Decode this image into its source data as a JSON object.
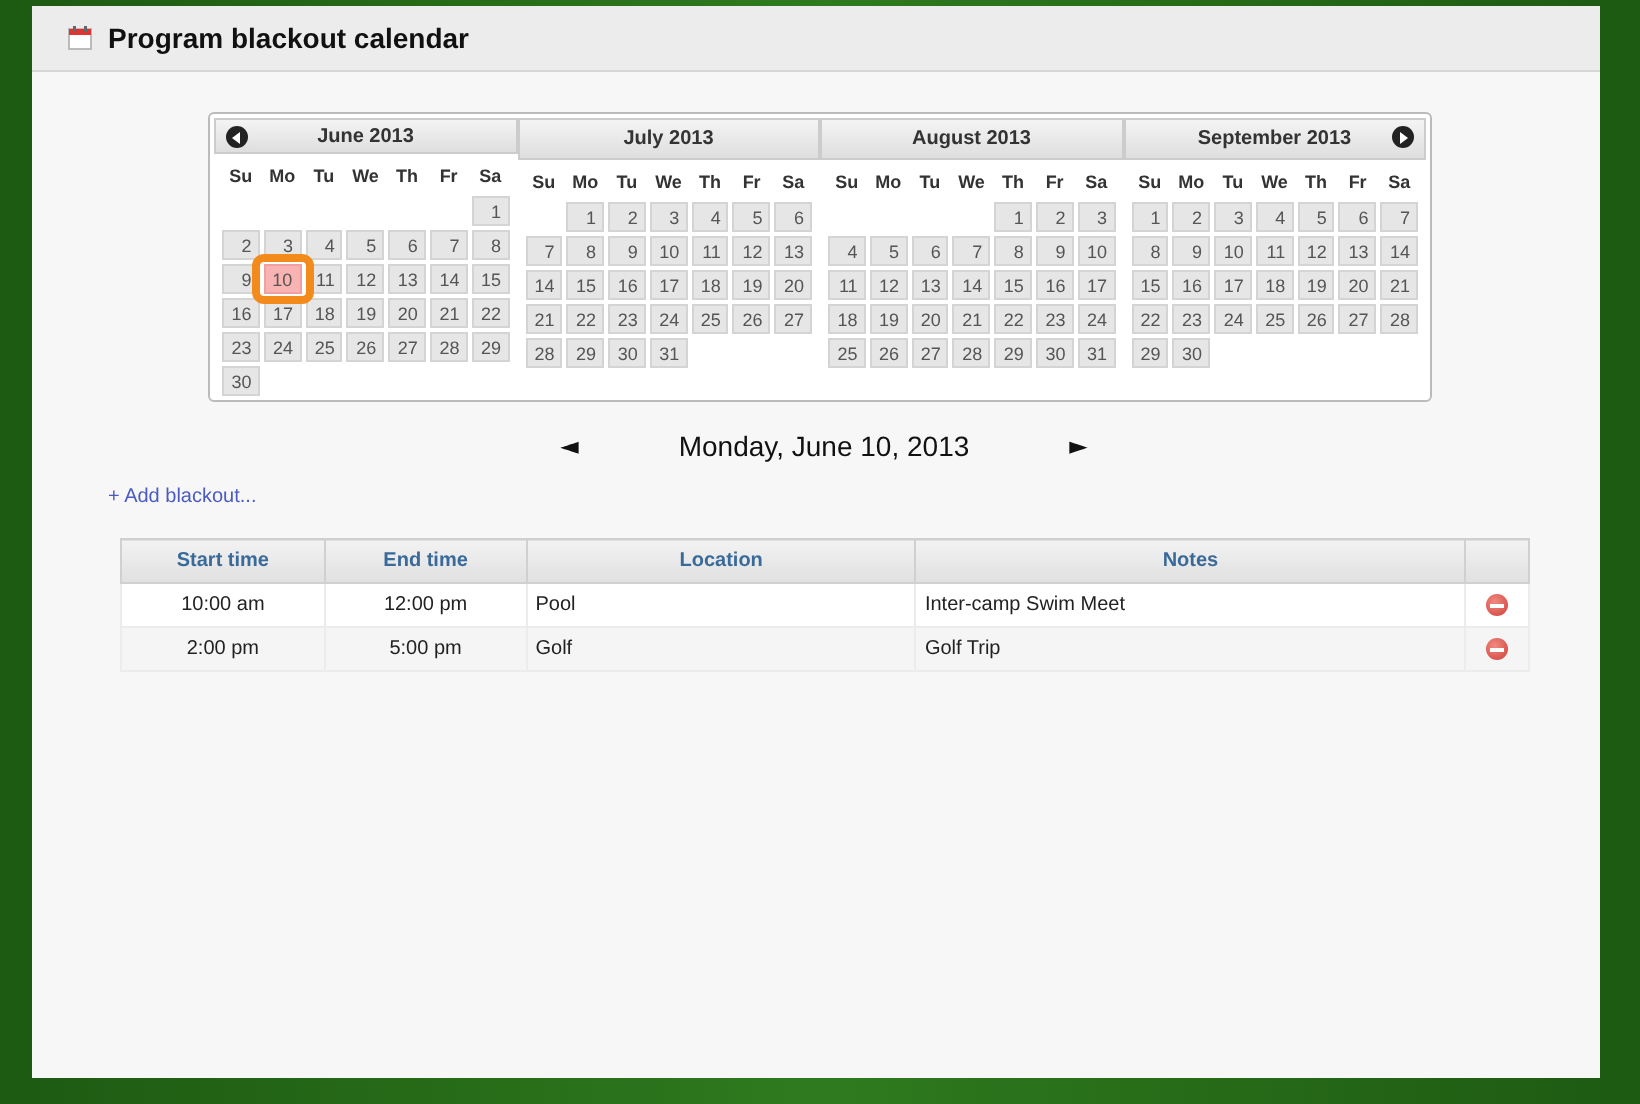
{
  "header": {
    "title": "Program blackout calendar"
  },
  "calendar": {
    "months": [
      {
        "title": "June 2013",
        "prev_button": true,
        "next_button": false,
        "weekdays": [
          "Su",
          "Mo",
          "Tu",
          "We",
          "Th",
          "Fr",
          "Sa"
        ],
        "weeks": [
          [
            {
              "kind": "blank"
            },
            {
              "kind": "blank"
            },
            {
              "kind": "blank"
            },
            {
              "kind": "blank"
            },
            {
              "kind": "blank"
            },
            {
              "kind": "blank"
            },
            {
              "kind": "day",
              "day": "1",
              "selected": false
            }
          ],
          [
            {
              "kind": "day",
              "day": "2",
              "selected": false
            },
            {
              "kind": "day",
              "day": "3",
              "selected": false
            },
            {
              "kind": "day",
              "day": "4",
              "selected": false
            },
            {
              "kind": "day",
              "day": "5",
              "selected": false
            },
            {
              "kind": "day",
              "day": "6",
              "selected": false
            },
            {
              "kind": "day",
              "day": "7",
              "selected": false
            },
            {
              "kind": "day",
              "day": "8",
              "selected": false
            }
          ],
          [
            {
              "kind": "day",
              "day": "9",
              "selected": false
            },
            {
              "kind": "day",
              "day": "10",
              "selected": true
            },
            {
              "kind": "day",
              "day": "11",
              "selected": false
            },
            {
              "kind": "day",
              "day": "12",
              "selected": false
            },
            {
              "kind": "day",
              "day": "13",
              "selected": false
            },
            {
              "kind": "day",
              "day": "14",
              "selected": false
            },
            {
              "kind": "day",
              "day": "15",
              "selected": false
            }
          ],
          [
            {
              "kind": "day",
              "day": "16",
              "selected": false
            },
            {
              "kind": "day",
              "day": "17",
              "selected": false
            },
            {
              "kind": "day",
              "day": "18",
              "selected": false
            },
            {
              "kind": "day",
              "day": "19",
              "selected": false
            },
            {
              "kind": "day",
              "day": "20",
              "selected": false
            },
            {
              "kind": "day",
              "day": "21",
              "selected": false
            },
            {
              "kind": "day",
              "day": "22",
              "selected": false
            }
          ],
          [
            {
              "kind": "day",
              "day": "23",
              "selected": false
            },
            {
              "kind": "day",
              "day": "24",
              "selected": false
            },
            {
              "kind": "day",
              "day": "25",
              "selected": false
            },
            {
              "kind": "day",
              "day": "26",
              "selected": false
            },
            {
              "kind": "day",
              "day": "27",
              "selected": false
            },
            {
              "kind": "day",
              "day": "28",
              "selected": false
            },
            {
              "kind": "day",
              "day": "29",
              "selected": false
            }
          ],
          [
            {
              "kind": "day",
              "day": "30",
              "selected": false
            }
          ]
        ]
      },
      {
        "title": "July 2013",
        "prev_button": false,
        "next_button": false,
        "weekdays": [
          "Su",
          "Mo",
          "Tu",
          "We",
          "Th",
          "Fr",
          "Sa"
        ],
        "weeks": [
          [
            {
              "kind": "blank"
            },
            {
              "kind": "day",
              "day": "1",
              "selected": false
            },
            {
              "kind": "day",
              "day": "2",
              "selected": false
            },
            {
              "kind": "day",
              "day": "3",
              "selected": false
            },
            {
              "kind": "day",
              "day": "4",
              "selected": false
            },
            {
              "kind": "day",
              "day": "5",
              "selected": false
            },
            {
              "kind": "day",
              "day": "6",
              "selected": false
            }
          ],
          [
            {
              "kind": "day",
              "day": "7",
              "selected": false
            },
            {
              "kind": "day",
              "day": "8",
              "selected": false
            },
            {
              "kind": "day",
              "day": "9",
              "selected": false
            },
            {
              "kind": "day",
              "day": "10",
              "selected": false
            },
            {
              "kind": "day",
              "day": "11",
              "selected": false
            },
            {
              "kind": "day",
              "day": "12",
              "selected": false
            },
            {
              "kind": "day",
              "day": "13",
              "selected": false
            }
          ],
          [
            {
              "kind": "day",
              "day": "14",
              "selected": false
            },
            {
              "kind": "day",
              "day": "15",
              "selected": false
            },
            {
              "kind": "day",
              "day": "16",
              "selected": false
            },
            {
              "kind": "day",
              "day": "17",
              "selected": false
            },
            {
              "kind": "day",
              "day": "18",
              "selected": false
            },
            {
              "kind": "day",
              "day": "19",
              "selected": false
            },
            {
              "kind": "day",
              "day": "20",
              "selected": false
            }
          ],
          [
            {
              "kind": "day",
              "day": "21",
              "selected": false
            },
            {
              "kind": "day",
              "day": "22",
              "selected": false
            },
            {
              "kind": "day",
              "day": "23",
              "selected": false
            },
            {
              "kind": "day",
              "day": "24",
              "selected": false
            },
            {
              "kind": "day",
              "day": "25",
              "selected": false
            },
            {
              "kind": "day",
              "day": "26",
              "selected": false
            },
            {
              "kind": "day",
              "day": "27",
              "selected": false
            }
          ],
          [
            {
              "kind": "day",
              "day": "28",
              "selected": false
            },
            {
              "kind": "day",
              "day": "29",
              "selected": false
            },
            {
              "kind": "day",
              "day": "30",
              "selected": false
            },
            {
              "kind": "day",
              "day": "31",
              "selected": false
            }
          ]
        ]
      },
      {
        "title": "August 2013",
        "prev_button": false,
        "next_button": false,
        "weekdays": [
          "Su",
          "Mo",
          "Tu",
          "We",
          "Th",
          "Fr",
          "Sa"
        ],
        "weeks": [
          [
            {
              "kind": "blank"
            },
            {
              "kind": "blank"
            },
            {
              "kind": "blank"
            },
            {
              "kind": "blank"
            },
            {
              "kind": "day",
              "day": "1",
              "selected": false
            },
            {
              "kind": "day",
              "day": "2",
              "selected": false
            },
            {
              "kind": "day",
              "day": "3",
              "selected": false
            }
          ],
          [
            {
              "kind": "day",
              "day": "4",
              "selected": false
            },
            {
              "kind": "day",
              "day": "5",
              "selected": false
            },
            {
              "kind": "day",
              "day": "6",
              "selected": false
            },
            {
              "kind": "day",
              "day": "7",
              "selected": false
            },
            {
              "kind": "day",
              "day": "8",
              "selected": false
            },
            {
              "kind": "day",
              "day": "9",
              "selected": false
            },
            {
              "kind": "day",
              "day": "10",
              "selected": false
            }
          ],
          [
            {
              "kind": "day",
              "day": "11",
              "selected": false
            },
            {
              "kind": "day",
              "day": "12",
              "selected": false
            },
            {
              "kind": "day",
              "day": "13",
              "selected": false
            },
            {
              "kind": "day",
              "day": "14",
              "selected": false
            },
            {
              "kind": "day",
              "day": "15",
              "selected": false
            },
            {
              "kind": "day",
              "day": "16",
              "selected": false
            },
            {
              "kind": "day",
              "day": "17",
              "selected": false
            }
          ],
          [
            {
              "kind": "day",
              "day": "18",
              "selected": false
            },
            {
              "kind": "day",
              "day": "19",
              "selected": false
            },
            {
              "kind": "day",
              "day": "20",
              "selected": false
            },
            {
              "kind": "day",
              "day": "21",
              "selected": false
            },
            {
              "kind": "day",
              "day": "22",
              "selected": false
            },
            {
              "kind": "day",
              "day": "23",
              "selected": false
            },
            {
              "kind": "day",
              "day": "24",
              "selected": false
            }
          ],
          [
            {
              "kind": "day",
              "day": "25",
              "selected": false
            },
            {
              "kind": "day",
              "day": "26",
              "selected": false
            },
            {
              "kind": "day",
              "day": "27",
              "selected": false
            },
            {
              "kind": "day",
              "day": "28",
              "selected": false
            },
            {
              "kind": "day",
              "day": "29",
              "selected": false
            },
            {
              "kind": "day",
              "day": "30",
              "selected": false
            },
            {
              "kind": "day",
              "day": "31",
              "selected": false
            }
          ]
        ]
      },
      {
        "title": "September 2013",
        "prev_button": false,
        "next_button": true,
        "weekdays": [
          "Su",
          "Mo",
          "Tu",
          "We",
          "Th",
          "Fr",
          "Sa"
        ],
        "weeks": [
          [
            {
              "kind": "day",
              "day": "1",
              "selected": false
            },
            {
              "kind": "day",
              "day": "2",
              "selected": false
            },
            {
              "kind": "day",
              "day": "3",
              "selected": false
            },
            {
              "kind": "day",
              "day": "4",
              "selected": false
            },
            {
              "kind": "day",
              "day": "5",
              "selected": false
            },
            {
              "kind": "day",
              "day": "6",
              "selected": false
            },
            {
              "kind": "day",
              "day": "7",
              "selected": false
            }
          ],
          [
            {
              "kind": "day",
              "day": "8",
              "selected": false
            },
            {
              "kind": "day",
              "day": "9",
              "selected": false
            },
            {
              "kind": "day",
              "day": "10",
              "selected": false
            },
            {
              "kind": "day",
              "day": "11",
              "selected": false
            },
            {
              "kind": "day",
              "day": "12",
              "selected": false
            },
            {
              "kind": "day",
              "day": "13",
              "selected": false
            },
            {
              "kind": "day",
              "day": "14",
              "selected": false
            }
          ],
          [
            {
              "kind": "day",
              "day": "15",
              "selected": false
            },
            {
              "kind": "day",
              "day": "16",
              "selected": false
            },
            {
              "kind": "day",
              "day": "17",
              "selected": false
            },
            {
              "kind": "day",
              "day": "18",
              "selected": false
            },
            {
              "kind": "day",
              "day": "19",
              "selected": false
            },
            {
              "kind": "day",
              "day": "20",
              "selected": false
            },
            {
              "kind": "day",
              "day": "21",
              "selected": false
            }
          ],
          [
            {
              "kind": "day",
              "day": "22",
              "selected": false
            },
            {
              "kind": "day",
              "day": "23",
              "selected": false
            },
            {
              "kind": "day",
              "day": "24",
              "selected": false
            },
            {
              "kind": "day",
              "day": "25",
              "selected": false
            },
            {
              "kind": "day",
              "day": "26",
              "selected": false
            },
            {
              "kind": "day",
              "day": "27",
              "selected": false
            },
            {
              "kind": "day",
              "day": "28",
              "selected": false
            }
          ],
          [
            {
              "kind": "day",
              "day": "29",
              "selected": false
            },
            {
              "kind": "day",
              "day": "30",
              "selected": false
            }
          ]
        ]
      }
    ]
  },
  "day_nav": {
    "prev": "◄",
    "date": "Monday, June 10, 2013",
    "next": "►"
  },
  "add_link": "+ Add blackout...",
  "table": {
    "columns": [
      "Start time",
      "End time",
      "Location",
      "Notes"
    ],
    "rows": [
      {
        "start": "10:00 am",
        "end": "12:00 pm",
        "location": "Pool",
        "notes": "Inter-camp Swim Meet"
      },
      {
        "start": "2:00 pm",
        "end": "5:00 pm",
        "location": "Golf",
        "notes": "Golf Trip"
      }
    ]
  }
}
